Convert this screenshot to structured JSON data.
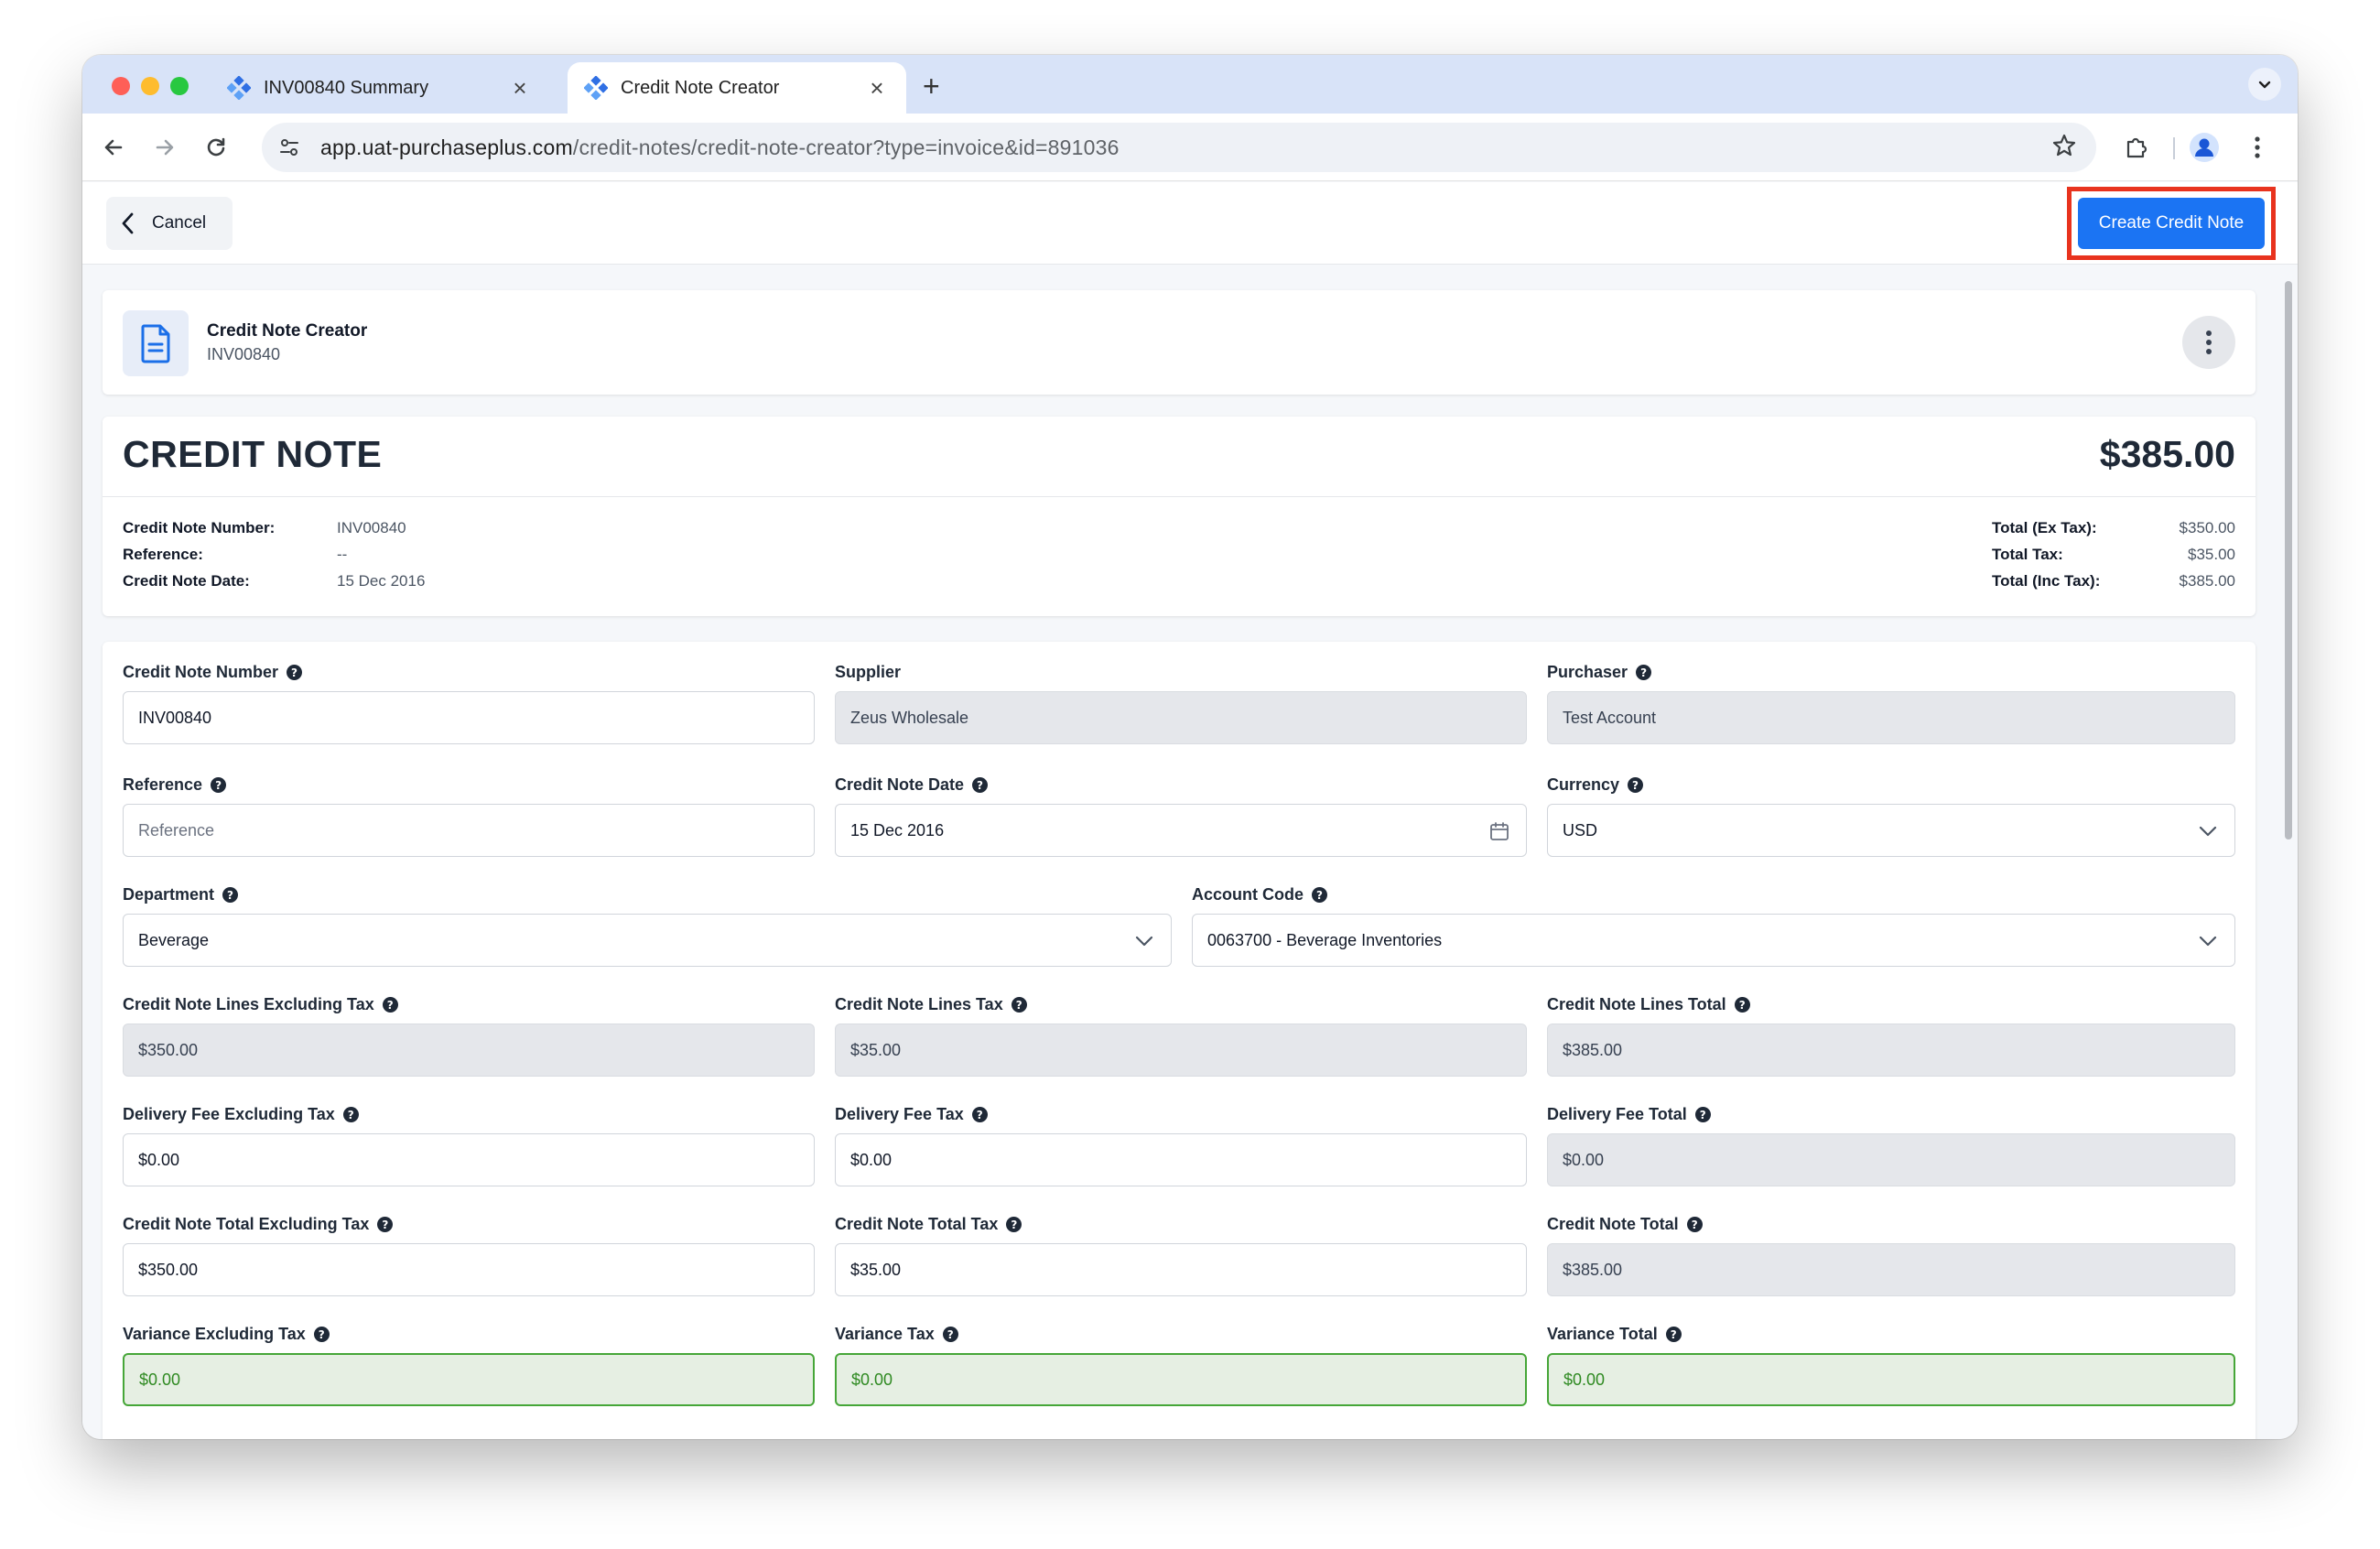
{
  "browser": {
    "tabs": [
      {
        "title": "INV00840 Summary",
        "active": false
      },
      {
        "title": "Credit Note Creator",
        "active": true
      }
    ],
    "url_host": "app.uat-purchaseplus.com",
    "url_path": "/credit-notes/credit-note-creator?type=invoice&id=891036",
    "icons": [
      "back-icon",
      "forward-icon",
      "reload-icon",
      "site-settings-icon",
      "bookmark-star-icon",
      "extensions-icon",
      "profile-icon",
      "menu-kebab-icon"
    ]
  },
  "topbar": {
    "cancel_label": "Cancel",
    "create_label": "Create Credit Note"
  },
  "header_card": {
    "title": "Credit Note Creator",
    "subtitle": "INV00840"
  },
  "summary": {
    "heading": "CREDIT NOTE",
    "total": "$385.00",
    "meta": [
      {
        "label": "Credit Note Number:",
        "value": "INV00840"
      },
      {
        "label": "Reference:",
        "value": "--"
      },
      {
        "label": "Credit Note Date:",
        "value": "15 Dec 2016"
      }
    ],
    "totals": [
      {
        "label": "Total (Ex Tax):",
        "value": "$350.00"
      },
      {
        "label": "Total Tax:",
        "value": "$35.00"
      },
      {
        "label": "Total (Inc Tax):",
        "value": "$385.00"
      }
    ]
  },
  "form": {
    "credit_note_number": {
      "label": "Credit Note Number",
      "value": "INV00840"
    },
    "supplier": {
      "label": "Supplier",
      "value": "Zeus Wholesale"
    },
    "purchaser": {
      "label": "Purchaser",
      "value": "Test Account"
    },
    "reference": {
      "label": "Reference",
      "placeholder": "Reference"
    },
    "credit_note_date": {
      "label": "Credit Note Date",
      "value": "15 Dec 2016"
    },
    "currency": {
      "label": "Currency",
      "value": "USD"
    },
    "department": {
      "label": "Department",
      "value": "Beverage"
    },
    "account_code": {
      "label": "Account Code",
      "value": "0063700 - Beverage Inventories"
    },
    "lines_ex_tax": {
      "label": "Credit Note Lines Excluding Tax",
      "value": "$350.00"
    },
    "lines_tax": {
      "label": "Credit Note Lines Tax",
      "value": "$35.00"
    },
    "lines_total": {
      "label": "Credit Note Lines Total",
      "value": "$385.00"
    },
    "delivery_ex_tax": {
      "label": "Delivery Fee Excluding Tax",
      "value": "$0.00"
    },
    "delivery_tax": {
      "label": "Delivery Fee Tax",
      "value": "$0.00"
    },
    "delivery_total": {
      "label": "Delivery Fee Total",
      "value": "$0.00"
    },
    "total_ex_tax": {
      "label": "Credit Note Total Excluding Tax",
      "value": "$350.00"
    },
    "total_tax": {
      "label": "Credit Note Total Tax",
      "value": "$35.00"
    },
    "total": {
      "label": "Credit Note Total",
      "value": "$385.00"
    },
    "variance_ex_tax": {
      "label": "Variance Excluding Tax",
      "value": "$0.00"
    },
    "variance_tax": {
      "label": "Variance Tax",
      "value": "$0.00"
    },
    "variance_total": {
      "label": "Variance Total",
      "value": "$0.00"
    }
  },
  "colors": {
    "primary": "#1b74f3",
    "highlight": "#e8331e",
    "success": "#46a638"
  }
}
